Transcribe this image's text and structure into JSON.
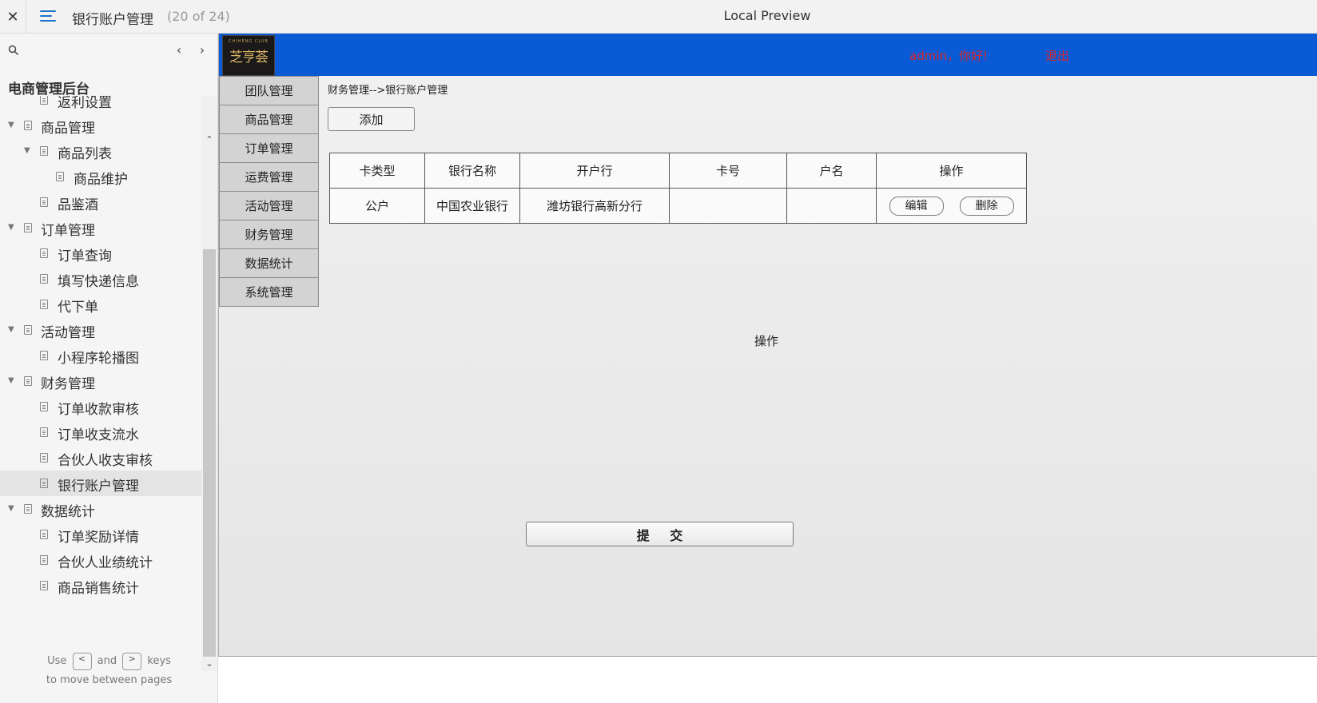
{
  "topbar": {
    "close_glyph": "✕",
    "title": "银行账户管理",
    "page_count": "(20 of 24)",
    "center_title": "Local Preview"
  },
  "sidebar": {
    "root_label": "电商管理后台",
    "prev_glyph": "‹",
    "next_glyph": "›",
    "items": [
      {
        "label": "返利设置",
        "level": 1,
        "has_caret": false
      },
      {
        "label": "商品管理",
        "level": 0,
        "has_caret": true
      },
      {
        "label": "商品列表",
        "level": 1,
        "has_caret": true
      },
      {
        "label": "商品维护",
        "level": 2,
        "has_caret": false
      },
      {
        "label": "品鉴酒",
        "level": 1,
        "has_caret": false
      },
      {
        "label": "订单管理",
        "level": 0,
        "has_caret": true
      },
      {
        "label": "订单查询",
        "level": 1,
        "has_caret": false
      },
      {
        "label": "填写快递信息",
        "level": 1,
        "has_caret": false
      },
      {
        "label": "代下单",
        "level": 1,
        "has_caret": false
      },
      {
        "label": "活动管理",
        "level": 0,
        "has_caret": true
      },
      {
        "label": "小程序轮播图",
        "level": 1,
        "has_caret": false
      },
      {
        "label": "财务管理",
        "level": 0,
        "has_caret": true
      },
      {
        "label": "订单收款审核",
        "level": 1,
        "has_caret": false
      },
      {
        "label": "订单收支流水",
        "level": 1,
        "has_caret": false
      },
      {
        "label": "合伙人收支审核",
        "level": 1,
        "has_caret": false
      },
      {
        "label": "银行账户管理",
        "level": 1,
        "has_caret": false,
        "selected": true
      },
      {
        "label": "数据统计",
        "level": 0,
        "has_caret": true
      },
      {
        "label": "订单奖励详情",
        "level": 1,
        "has_caret": false
      },
      {
        "label": "合伙人业绩统计",
        "level": 1,
        "has_caret": false
      },
      {
        "label": "商品销售统计",
        "level": 1,
        "has_caret": false
      }
    ],
    "hint": {
      "use": "Use",
      "key_prev": "<",
      "and": "and",
      "key_next": ">",
      "keys": "keys",
      "line2": "to move between pages"
    }
  },
  "preview": {
    "logo_text": "芝亨荟",
    "logo_sub": "CHIHENG CLUB",
    "greeting": "admin，你好!",
    "logout": "退出",
    "menu": [
      "团队管理",
      "商品管理",
      "订单管理",
      "运费管理",
      "活动管理",
      "财务管理",
      "数据统计",
      "系统管理"
    ],
    "breadcrumb": "财务管理-->银行账户管理",
    "add_label": "添加",
    "table": {
      "headers": [
        "卡类型",
        "银行名称",
        "开户行",
        "卡号",
        "户名",
        "操作"
      ],
      "rows": [
        {
          "card_type": "公户",
          "bank_name": "中国农业银行",
          "branch": "潍坊银行高新分行",
          "card_no": "",
          "holder": "",
          "edit_label": "编辑",
          "delete_label": "删除"
        }
      ]
    },
    "op_label": "操作",
    "submit_label": "提 交"
  },
  "colors": {
    "banner": "#0a5ad6",
    "accent_red": "#d92a2a",
    "hamburger": "#1a73c8"
  }
}
